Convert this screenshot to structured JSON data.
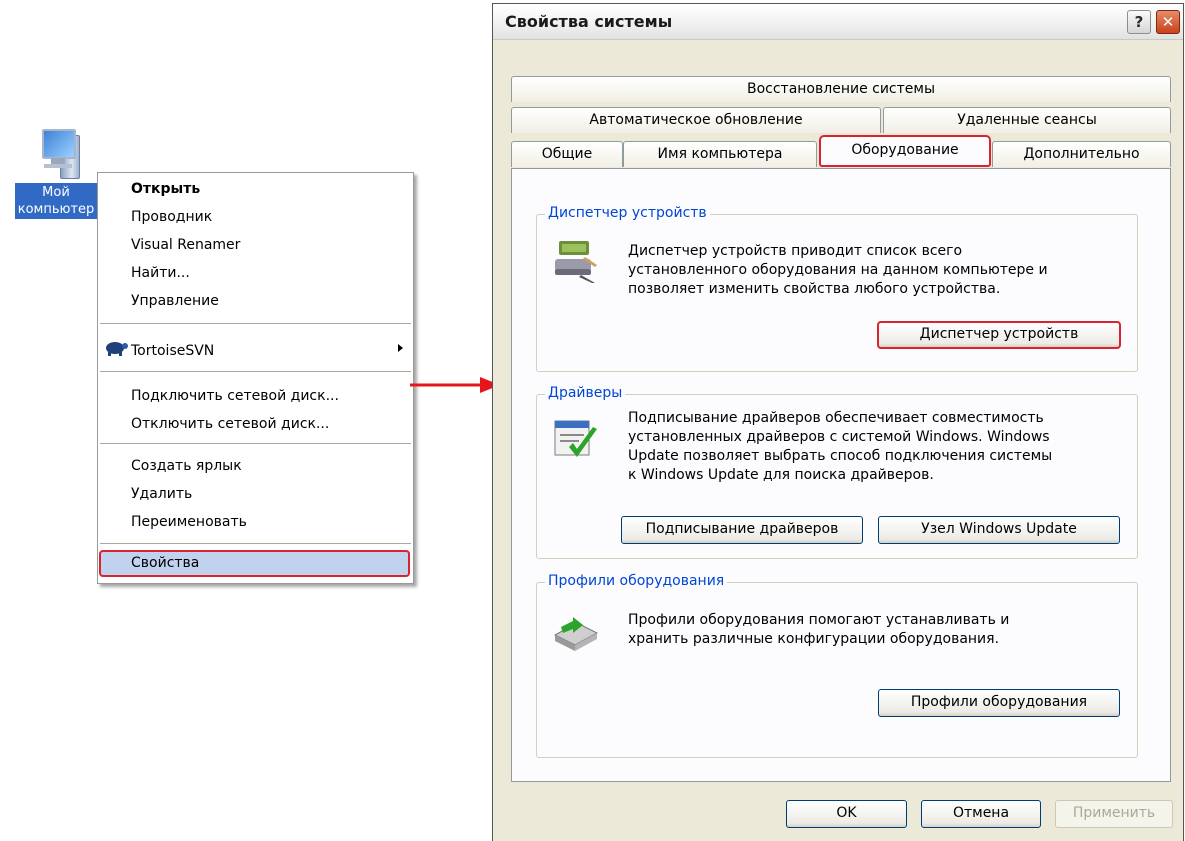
{
  "desktop": {
    "icon_label_line1": "Мой",
    "icon_label_line2": "компьютер"
  },
  "context_menu": {
    "items": [
      {
        "label": "Открыть"
      },
      {
        "label": "Проводник"
      },
      {
        "label": "Visual Renamer"
      },
      {
        "label": "Найти..."
      },
      {
        "label": "Управление"
      },
      {
        "label": "TortoiseSVN"
      },
      {
        "label": "Подключить сетевой диск..."
      },
      {
        "label": "Отключить сетевой диск..."
      },
      {
        "label": "Создать ярлык"
      },
      {
        "label": "Удалить"
      },
      {
        "label": "Переименовать"
      },
      {
        "label": "Свойства"
      }
    ]
  },
  "dialog": {
    "title": "Свойства системы",
    "help_glyph": "?",
    "close_glyph": "✕",
    "tabs": [
      {
        "label": "Восстановление системы"
      },
      {
        "label": "Автоматическое обновление"
      },
      {
        "label": "Удаленные сеансы"
      },
      {
        "label": "Общие"
      },
      {
        "label": "Имя компьютера"
      },
      {
        "label": "Оборудование"
      },
      {
        "label": "Дополнительно"
      }
    ],
    "groups": {
      "device_manager": {
        "legend": "Диспетчер устройств",
        "description": "Диспетчер устройств приводит список всего\nустановленного оборудования на данном компьютере и\nпозволяет изменить свойства любого устройства.",
        "button": "Диспетчер устройств"
      },
      "drivers": {
        "legend": "Драйверы",
        "description": "Подписывание драйверов обеспечивает совместимость\nустановленных драйверов с системой Windows.  Windows\nUpdate позволяет выбрать способ подключения системы\nк Windows Update для поиска драйверов.",
        "button_signing": "Подписывание драйверов",
        "button_update": "Узел Windows Update"
      },
      "profiles": {
        "legend": "Профили оборудования",
        "description": "Профили оборудования помогают устанавливать и\nхранить различные конфигурации оборудования.",
        "button": "Профили оборудования"
      }
    },
    "footer": {
      "ok": "OK",
      "cancel": "Отмена",
      "apply": "Применить"
    }
  },
  "colors": {
    "highlight_red": "#d9232f",
    "group_legend_blue": "#0046d5",
    "dialog_bg": "#ece9d8",
    "selection_bg": "#316ac5"
  }
}
